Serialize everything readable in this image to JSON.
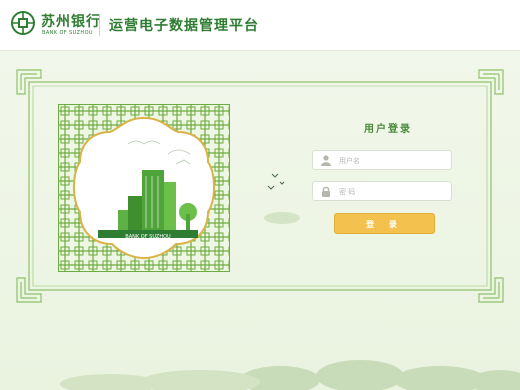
{
  "brand": {
    "name_cn": "苏州银行",
    "name_en": "BANK OF SUZHOU",
    "logo_icon": "bank-logo-icon",
    "color": "#2f7d33"
  },
  "header": {
    "platform_title": "运营电子数据管理平台"
  },
  "illustration": {
    "sign_text": "BANK OF SUZHOU"
  },
  "login": {
    "title": "用户登录",
    "username": {
      "placeholder": "用户名",
      "value": "",
      "icon": "user-icon"
    },
    "password": {
      "placeholder": "密  码",
      "value": "",
      "icon": "lock-icon"
    },
    "submit_label": "登 录",
    "submit_color": "#f2c14e"
  },
  "colors": {
    "lattice_green": "#6cab3d",
    "background": "#f1f7ea"
  }
}
